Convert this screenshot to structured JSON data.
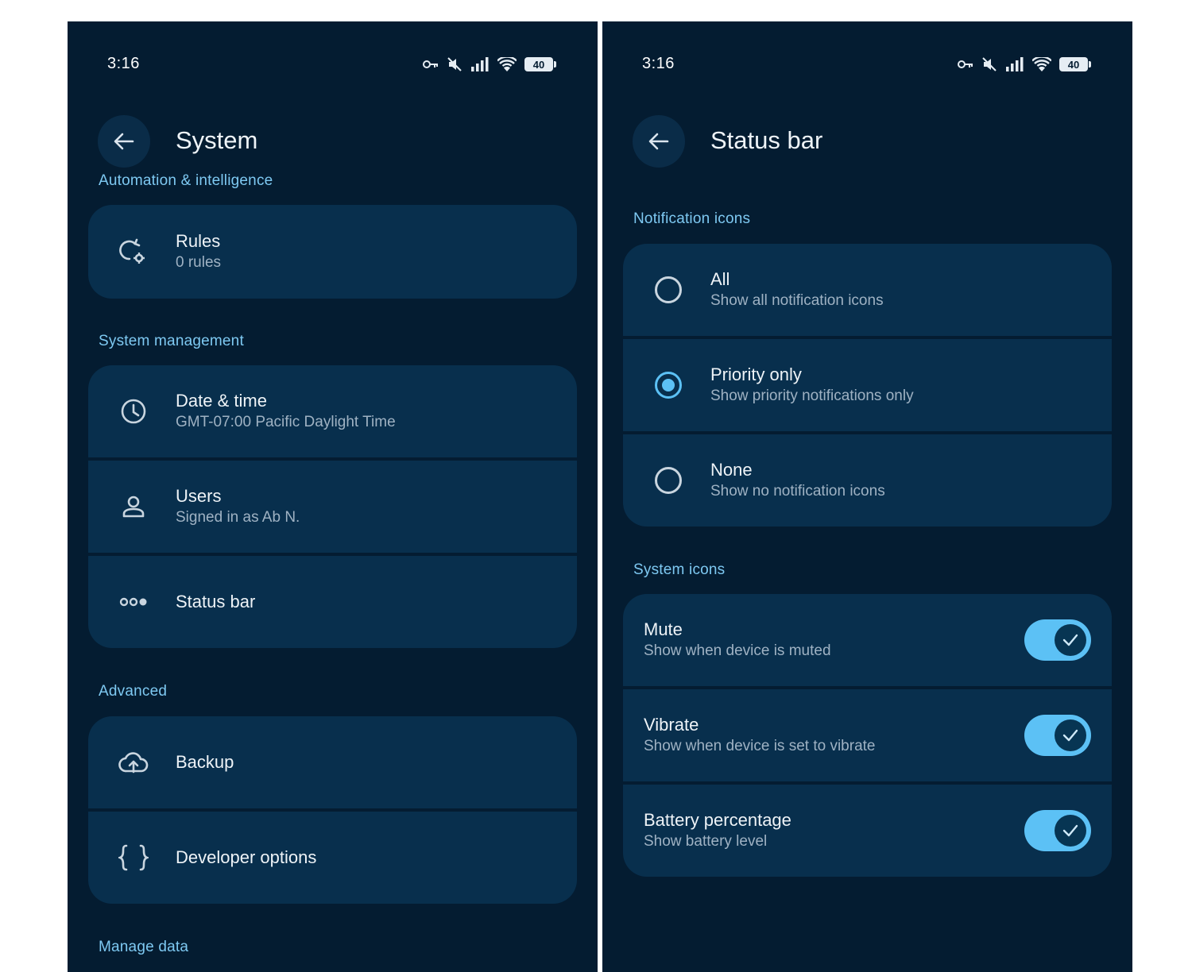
{
  "left": {
    "status": {
      "time": "3:16",
      "battery": "40"
    },
    "title": "System",
    "sections": {
      "automation": "Automation & intelligence",
      "system_management": "System management",
      "advanced": "Advanced",
      "manage_data": "Manage data"
    },
    "items": {
      "rules": {
        "title": "Rules",
        "sub": "0 rules",
        "icon": "rules-icon"
      },
      "date_time": {
        "title": "Date & time",
        "sub": "GMT-07:00 Pacific Daylight Time",
        "icon": "clock-icon"
      },
      "users": {
        "title": "Users",
        "sub": "Signed in as Ab N.",
        "icon": "person-icon"
      },
      "status_bar": {
        "title": "Status bar",
        "icon": "dots-icon"
      },
      "backup": {
        "title": "Backup",
        "icon": "cloud-upload-icon"
      },
      "developer": {
        "title": "Developer options",
        "icon": "braces-icon"
      }
    }
  },
  "right": {
    "status": {
      "time": "3:16",
      "battery": "40"
    },
    "title": "Status bar",
    "sections": {
      "notification_icons": "Notification icons",
      "system_icons": "System icons"
    },
    "notification_options": [
      {
        "title": "All",
        "sub": "Show all notification icons",
        "selected": false
      },
      {
        "title": "Priority only",
        "sub": "Show priority notifications only",
        "selected": true
      },
      {
        "title": "None",
        "sub": "Show no notification icons",
        "selected": false
      }
    ],
    "system_toggles": [
      {
        "title": "Mute",
        "sub": "Show when device is muted",
        "on": true
      },
      {
        "title": "Vibrate",
        "sub": "Show when device is set to vibrate",
        "on": true
      },
      {
        "title": "Battery percentage",
        "sub": "Show battery level",
        "on": true
      }
    ]
  },
  "colors": {
    "background": "#041c31",
    "card": "#082f4d",
    "accent": "#5cc1f5",
    "section_label": "#7ec9f2"
  }
}
